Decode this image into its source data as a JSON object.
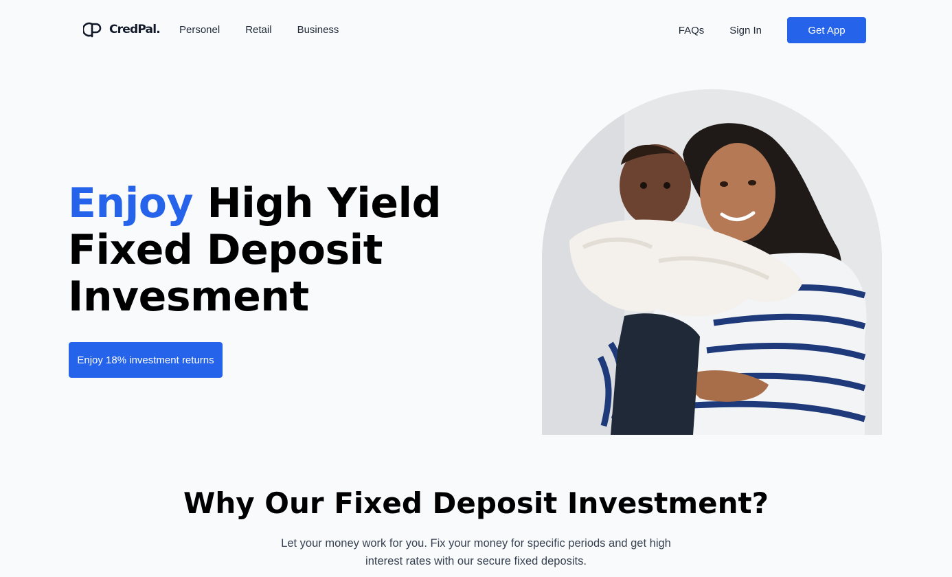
{
  "header": {
    "logo_text": "CredPal.",
    "nav": [
      {
        "label": "Personel"
      },
      {
        "label": "Retail"
      },
      {
        "label": "Business"
      }
    ],
    "faqs_label": "FAQs",
    "sign_in_label": "Sign In",
    "get_app_label": "Get App"
  },
  "hero": {
    "title_accent": "Enjoy",
    "title_rest_line1": "High Yield",
    "title_line2": "Fixed Deposit",
    "title_line3": "Invesment",
    "cta_label": "Enjoy 18% investment returns",
    "image_alt": "Smiling mother holding a baby"
  },
  "why": {
    "title": "Why Our Fixed Deposit Investment?",
    "description": "Let your money work for you. Fix your money for specific periods and get high interest rates with our secure fixed deposits."
  },
  "colors": {
    "accent": "#2563eb",
    "background": "#f8fafc",
    "text": "#111827"
  },
  "icons": {
    "logo": "credpal-logo-icon"
  }
}
